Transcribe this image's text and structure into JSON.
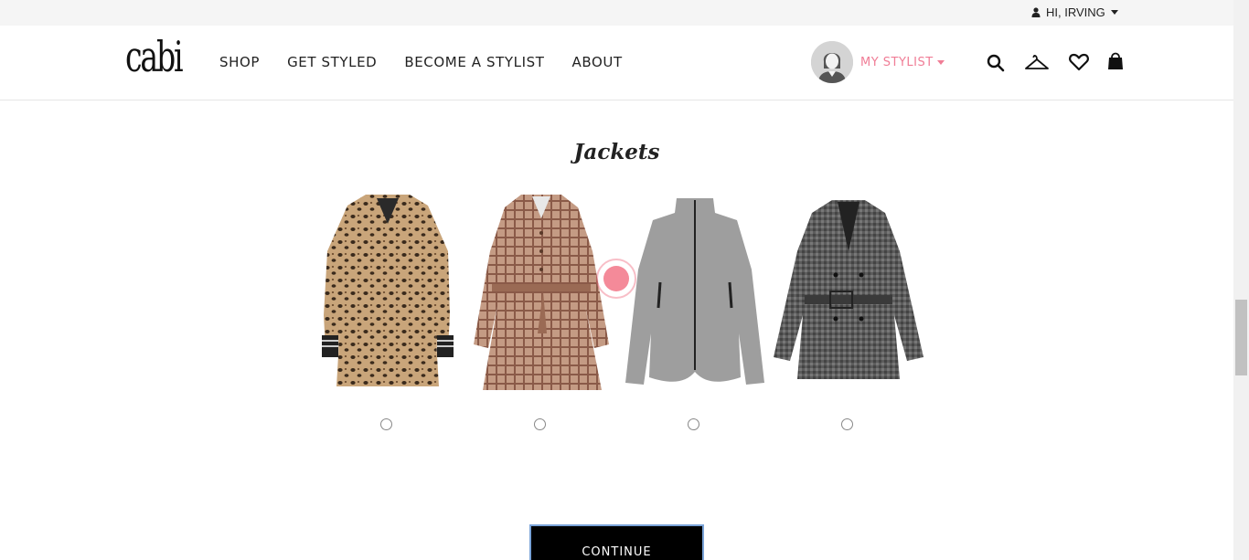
{
  "topbar": {
    "greeting": "HI, IRVING"
  },
  "header": {
    "logo": "cabi",
    "nav": [
      "SHOP",
      "GET STYLED",
      "BECOME A STYLIST",
      "ABOUT"
    ],
    "stylist_label": "MY STYLIST"
  },
  "section": {
    "title": "Jackets",
    "products": [
      {
        "name": "leopard-faux-fur-coat",
        "color": "#b38c5e"
      },
      {
        "name": "plaid-trench-coat",
        "color": "#b07f6a"
      },
      {
        "name": "gray-zip-jacket",
        "color": "#9a9a9a"
      },
      {
        "name": "tweed-belted-blazer",
        "color": "#555555"
      }
    ]
  },
  "actions": {
    "continue_label": "CONTINUE"
  },
  "colors": {
    "accent": "#f07d96",
    "button": "#000000"
  }
}
